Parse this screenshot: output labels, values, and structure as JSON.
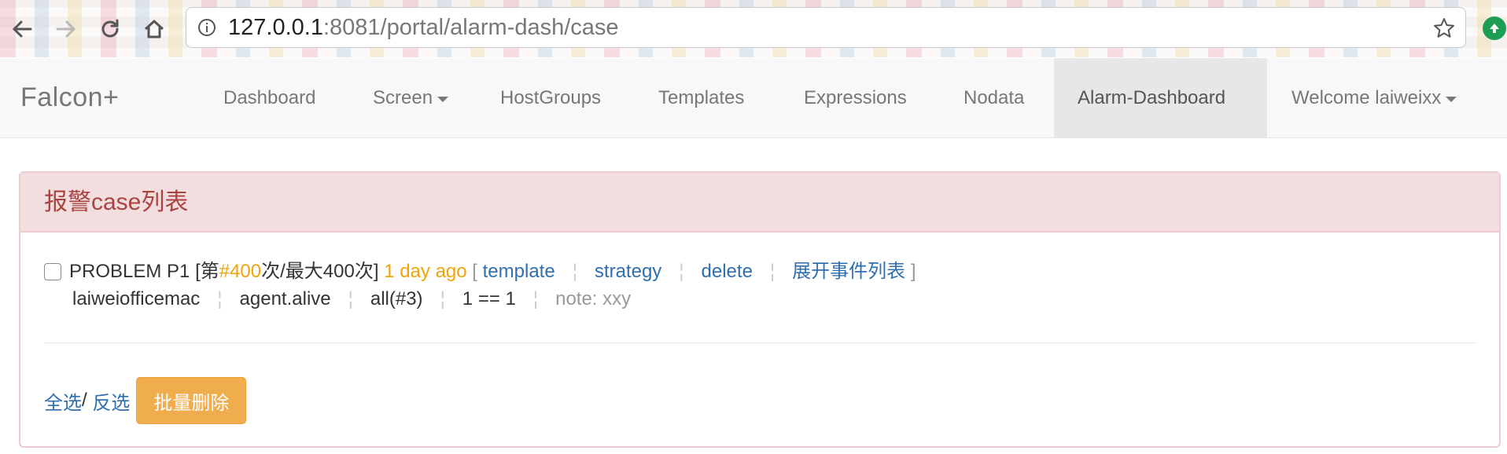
{
  "browser": {
    "url_host": "127.0.0.1",
    "url_rest": ":8081/portal/alarm-dash/case"
  },
  "navbar": {
    "brand": "Falcon+",
    "items": [
      {
        "label": "Dashboard"
      },
      {
        "label": "Screen"
      },
      {
        "label": "HostGroups"
      },
      {
        "label": "Templates"
      },
      {
        "label": "Expressions"
      },
      {
        "label": "Nodata"
      },
      {
        "label": "Alarm-Dashboard",
        "active": true
      },
      {
        "label": "Welcome laiweixx"
      }
    ]
  },
  "panel": {
    "title": "报警case列表",
    "case": {
      "status": "PROBLEM P1",
      "count_prefix": "[第",
      "count_value": "#400",
      "count_suffix": "次/最大400次]",
      "time_ago": "1 day ago",
      "bracket_open": "[",
      "bracket_close": "]",
      "links": {
        "template": "template",
        "strategy": "strategy",
        "delete": "delete",
        "expand": "展开事件列表"
      },
      "host": "laiweiofficemac",
      "metric": "agent.alive",
      "tags": "all(#3)",
      "condition": "1 == 1",
      "note": "note: xxy"
    },
    "footer": {
      "select_all": "全选",
      "slash": "/",
      "invert": "反选",
      "batch_delete": "批量删除"
    }
  },
  "colors": {
    "panel_heading_bg": "#f2dede",
    "panel_title": "#a94442",
    "link": "#2f6fb0",
    "accent_orange": "#f0a30a",
    "warning_button": "#f0ad4e",
    "active_nav_bg": "#e7e7e7"
  }
}
